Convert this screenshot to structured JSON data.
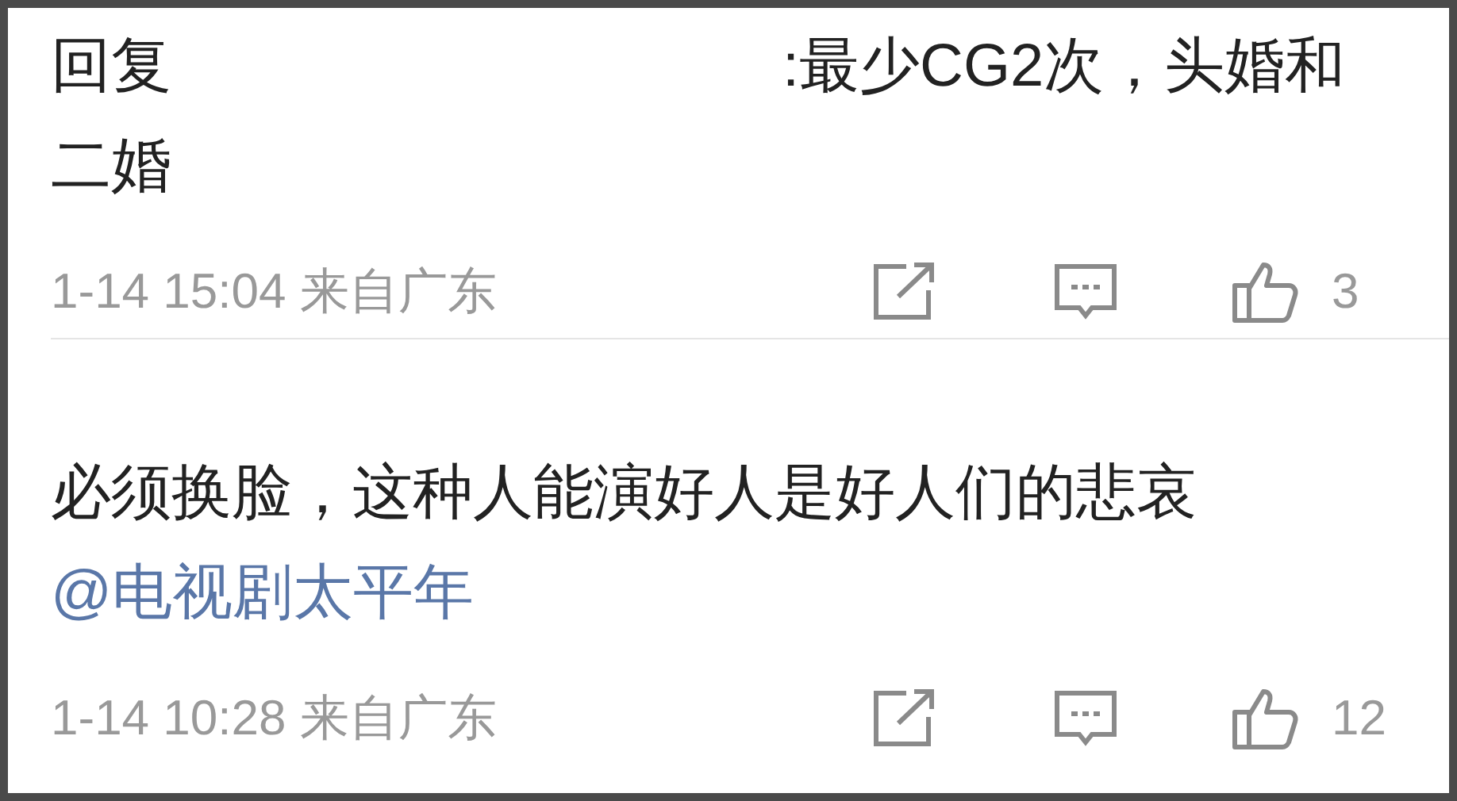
{
  "comments": [
    {
      "reply_prefix": "回复",
      "text": ":最少CG2次，头婚和二婚",
      "time": "1-14 15:04",
      "location": "来自广东",
      "likes": "3"
    },
    {
      "text": "必须换脸，这种人能演好人是好人们的悲哀",
      "mention": "@电视剧太平年",
      "time": "1-14 10:28",
      "location": "来自广东",
      "likes": "12"
    }
  ]
}
